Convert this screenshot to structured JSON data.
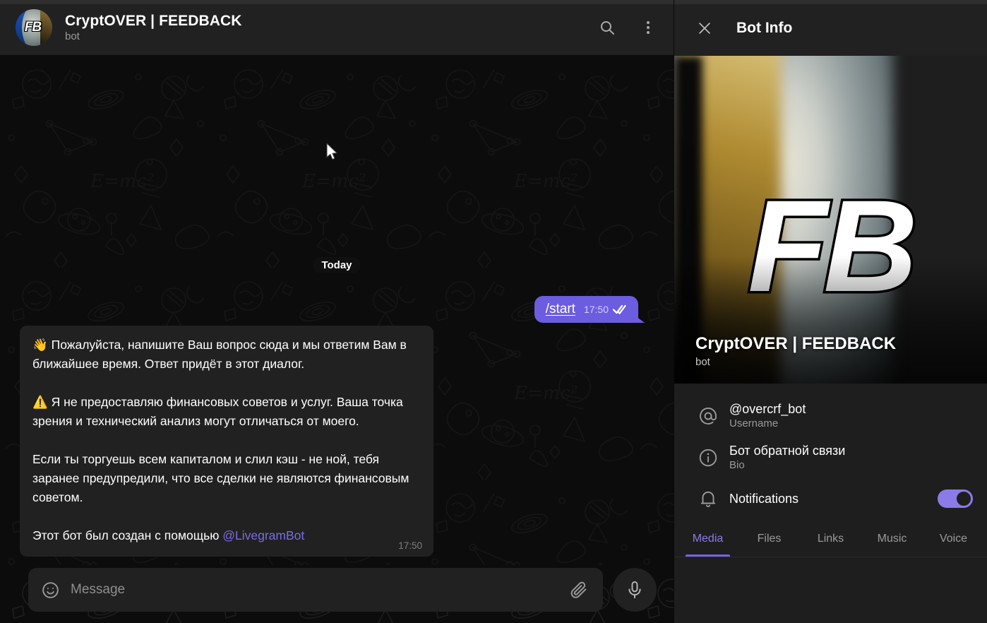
{
  "chat_header": {
    "title": "CryptOVER | FEEDBACK",
    "subtitle": "bot",
    "avatar_text": "FB",
    "search_icon": "search-icon",
    "menu_icon": "more-vertical-icon"
  },
  "chat": {
    "date_separator": "Today",
    "messages": [
      {
        "direction": "out",
        "text": "/start",
        "time": "17:50",
        "status": "read-double-check"
      },
      {
        "direction": "in",
        "text": "👋 Пожалуйста, напишите Ваш вопрос сюда и мы ответим Вам в ближайшее время. Ответ придёт в этот диалог.\n\n⚠️ Я не предоставляю финансовых советов и услуг. Ваша точка зрения и технический анализ могут отличаться от моего.\n\nЕсли ты торгуешь всем капиталом и слил кэш - не ной, тебя заранее предупредили, что все сделки не являются финансовым советом.\n\nЭтот бот был создан с помощью ",
        "mention": "@LivegramBot",
        "time": "17:50"
      }
    ]
  },
  "composer": {
    "placeholder": "Message",
    "value": "",
    "emoji_icon": "smiley-icon",
    "attach_icon": "paperclip-icon",
    "mic_icon": "microphone-icon"
  },
  "info_panel": {
    "header_title": "Bot Info",
    "close_icon": "close-icon",
    "profile": {
      "logo_text": "FB",
      "title": "CryptOVER | FEEDBACK",
      "subtitle": "bot"
    },
    "rows": [
      {
        "icon": "at-sign-icon",
        "value": "@overcrf_bot",
        "label": "Username",
        "type": "two-line"
      },
      {
        "icon": "info-circle-icon",
        "value": "Бот обратной связи",
        "label": "Bio",
        "type": "two-line"
      },
      {
        "icon": "bell-icon",
        "value": "Notifications",
        "label": "",
        "type": "toggle",
        "toggle_on": true
      }
    ],
    "tabs": [
      {
        "label": "Media",
        "active": true
      },
      {
        "label": "Files",
        "active": false
      },
      {
        "label": "Links",
        "active": false
      },
      {
        "label": "Music",
        "active": false
      },
      {
        "label": "Voice",
        "active": false
      }
    ]
  },
  "colors": {
    "accent": "#8B7BE8",
    "out_bubble": "#6C5CE0",
    "in_bubble": "#212121",
    "panel_bg": "#1E1E1E",
    "header_bg": "#212121",
    "chat_bg": "#0C0C0C",
    "mention": "#7C6CE8"
  }
}
